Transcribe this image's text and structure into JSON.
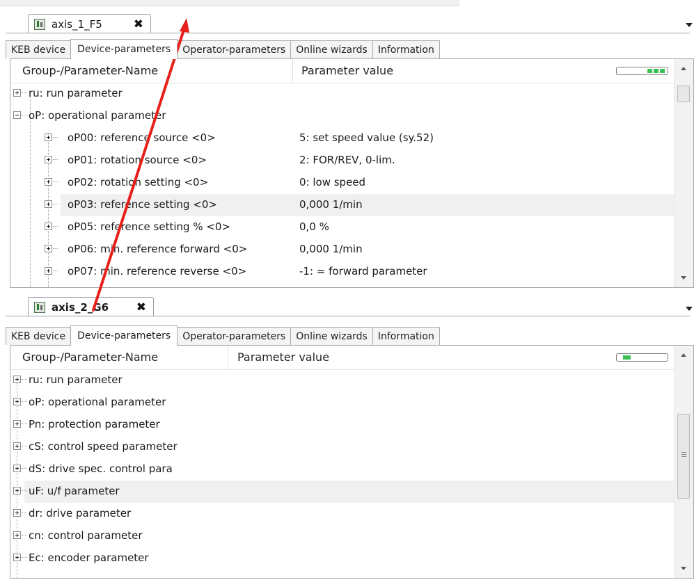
{
  "top_panel": {
    "doc_tab": {
      "title": "axis_1_F5",
      "close": "✖"
    },
    "sub_tabs": [
      "KEB device",
      "Device-parameters",
      "Operator-parameters",
      "Online wizards",
      "Information"
    ],
    "active_sub_tab": "Device-parameters",
    "columns": {
      "name": "Group-/Parameter-Name",
      "value": "Parameter value"
    },
    "rows": [
      {
        "name": "ru: run parameter",
        "value": "",
        "level": 0,
        "expander": "plus"
      },
      {
        "name": "oP: operational parameter",
        "value": "",
        "level": 0,
        "expander": "minus"
      },
      {
        "name": "oP00: reference source <0>",
        "value": "5: set speed value (sy.52)",
        "level": 1,
        "expander": "plus"
      },
      {
        "name": "oP01: rotation source <0>",
        "value": "2: FOR/REV, 0-lim.",
        "level": 1,
        "expander": "plus"
      },
      {
        "name": "oP02: rotation setting <0>",
        "value": "0: low speed",
        "level": 1,
        "expander": "plus"
      },
      {
        "name": "oP03: reference setting <0>",
        "value": "0,000 1/min",
        "level": 1,
        "expander": "plus",
        "highlight": true
      },
      {
        "name": "oP05: reference setting % <0>",
        "value": "0,0 %",
        "level": 1,
        "expander": "plus"
      },
      {
        "name": "oP06: min. reference forward <0>",
        "value": "0,000 1/min",
        "level": 1,
        "expander": "plus"
      },
      {
        "name": "oP07: min. reference reverse <0>",
        "value": "-1: = forward parameter",
        "level": 1,
        "expander": "plus"
      }
    ]
  },
  "bottom_panel": {
    "doc_tab": {
      "title": "axis_2_G6",
      "close": "✖"
    },
    "sub_tabs": [
      "KEB device",
      "Device-parameters",
      "Operator-parameters",
      "Online wizards",
      "Information"
    ],
    "active_sub_tab": "Device-parameters",
    "columns": {
      "name": "Group-/Parameter-Name",
      "value": "Parameter value"
    },
    "rows": [
      {
        "name": "ru: run parameter",
        "expander": "plus"
      },
      {
        "name": "oP: operational parameter",
        "expander": "plus"
      },
      {
        "name": "Pn: protection parameter",
        "expander": "plus"
      },
      {
        "name": "cS: control speed parameter",
        "expander": "plus"
      },
      {
        "name": "dS: drive spec. control para",
        "expander": "plus"
      },
      {
        "name": "uF: u/f parameter",
        "expander": "plus",
        "highlight": true
      },
      {
        "name": "dr: drive parameter",
        "expander": "plus"
      },
      {
        "name": "cn: control parameter",
        "expander": "plus"
      },
      {
        "name": "Ec: encoder parameter",
        "expander": "plus"
      }
    ]
  },
  "colors": {
    "annotation_arrow": "#e8201b",
    "indicator_green": "#39c155",
    "row_highlight": "#f0f0f0"
  },
  "indicators": {
    "top_filled_segments": 3,
    "bottom_filled_segments": 1
  }
}
